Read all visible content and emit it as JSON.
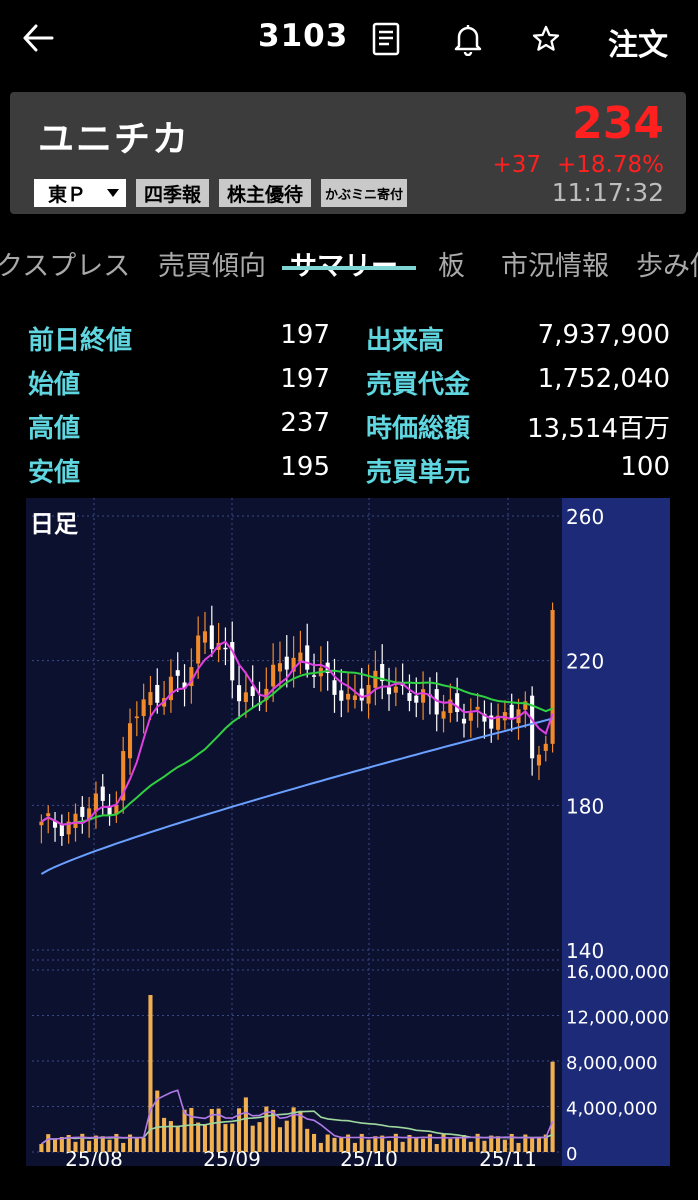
{
  "header": {
    "ticker": "3103",
    "order_label": "注文"
  },
  "quote": {
    "name": "ユニチカ",
    "price": "234",
    "change": "+37",
    "change_pct": "+18.78%",
    "time": "11:17:32",
    "market": "東Ｐ",
    "badges": [
      "四季報",
      "株主優待",
      "かぶミニ寄付"
    ],
    "up_color": "#ff2020"
  },
  "tabs": [
    {
      "label": "クスプレス"
    },
    {
      "label": "売買傾向"
    },
    {
      "label": "サマリー"
    },
    {
      "label": "板"
    },
    {
      "label": "市況情報"
    },
    {
      "label": "歩み値"
    }
  ],
  "active_tab": 2,
  "summary": [
    {
      "label": "前日終値",
      "value": "197"
    },
    {
      "label": "始値",
      "value": "197"
    },
    {
      "label": "高値",
      "value": "237"
    },
    {
      "label": "安値",
      "value": "195"
    },
    {
      "label": "出来高",
      "value": "7,937,900"
    },
    {
      "label": "売買代金",
      "value": "1,752,040"
    },
    {
      "label": "時価総額",
      "value": "13,514百万"
    },
    {
      "label": "売買単元",
      "value": "100"
    }
  ],
  "chart_data": {
    "type": "candlestick",
    "period_label": "日足",
    "price_axis": {
      "ticks": [
        "260",
        "220",
        "180",
        "140"
      ],
      "min": 140,
      "max": 260
    },
    "volume_axis": {
      "ticks": [
        "16,000,000",
        "12,000,000",
        "8,000,000",
        "4,000,000",
        "0"
      ],
      "min": 0,
      "max": 16000000
    },
    "x_labels": [
      "25/08",
      "25/09",
      "25/10",
      "25/11"
    ],
    "colors": {
      "up": "#f08a2a",
      "down": "#ffffff",
      "ma_short": "#e040e0",
      "ma_mid": "#30d040",
      "ma_long": "#6aa0ff",
      "volume": "#f0b050"
    },
    "last_close": 234,
    "last_volume": 7937900
  }
}
